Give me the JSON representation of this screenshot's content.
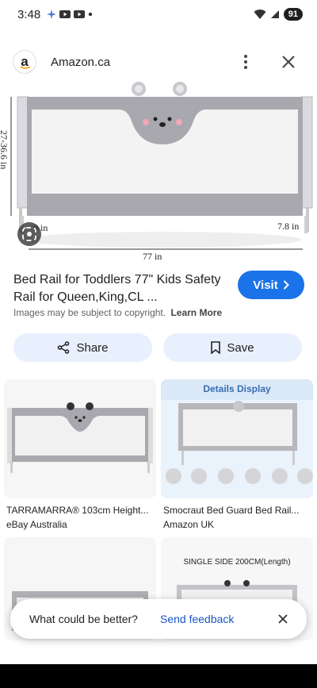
{
  "status_bar": {
    "time": "3:48",
    "battery": "91"
  },
  "header": {
    "site_name": "Amazon.ca",
    "logo_letter": "a"
  },
  "main_image": {
    "dims": {
      "height": "27-36.6 in",
      "left_gap": "9 in",
      "right_gap": "7.8 in",
      "length": "77 in"
    }
  },
  "result": {
    "title": "Bed Rail for Toddlers 77\" Kids Safety Rail for Queen,King,CL ...",
    "visit_label": "Visit",
    "copyright_text": "Images may be subject to copyright.",
    "learn_more": "Learn More"
  },
  "actions": {
    "share_label": "Share",
    "save_label": "Save"
  },
  "related": [
    {
      "title": "TARRAMARRA® 103cm Height...",
      "source": "eBay Australia"
    },
    {
      "title": "Smocraut Bed Guard Bed Rail...",
      "source": "Amazon UK",
      "overlay_text": "Details Display"
    },
    {
      "title": "",
      "source": ""
    },
    {
      "title": "",
      "source": "",
      "overlay_text": "SINGLE SIDE 200CM(Length)"
    }
  ],
  "feedback": {
    "question": "What could be better?",
    "send_label": "Send feedback"
  },
  "colors": {
    "accent": "#1a73e8",
    "action_bg": "#e8f0fe",
    "rail_gray": "#a9a8ae"
  }
}
